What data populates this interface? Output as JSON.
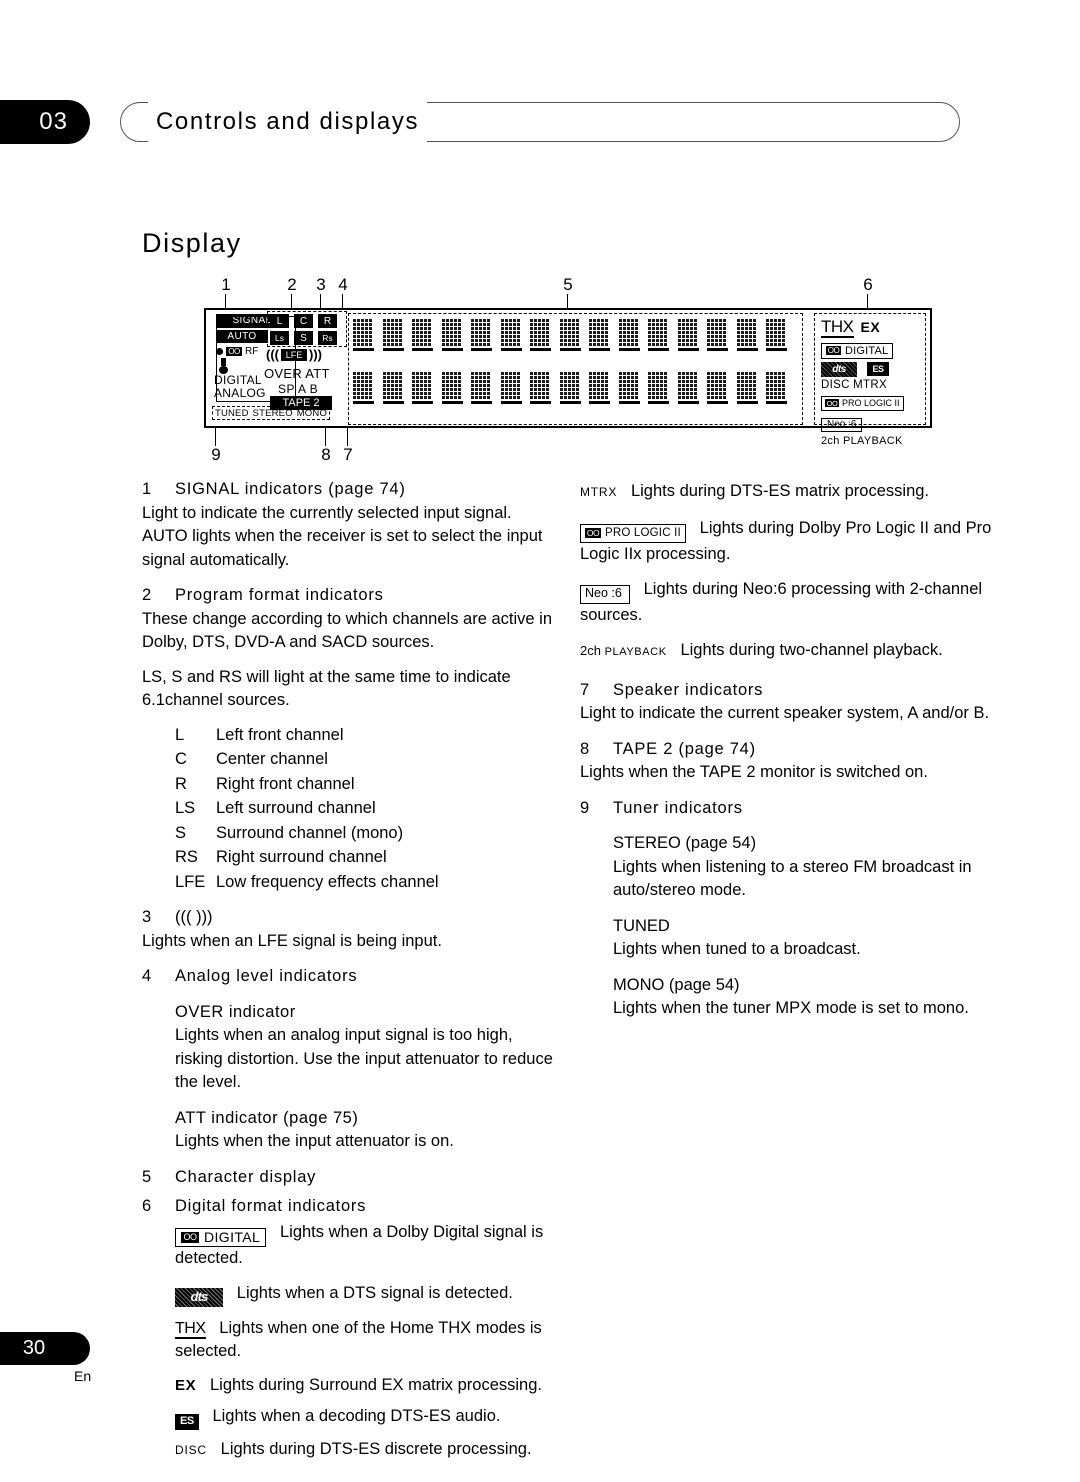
{
  "header": {
    "chapter_number": "03",
    "chapter_title": "Controls and displays"
  },
  "section_title": "Display",
  "diagram": {
    "callouts": [
      "1",
      "2",
      "3",
      "4",
      "5",
      "6",
      "7",
      "8",
      "9"
    ],
    "left_panel": {
      "signal": "SIGNAL",
      "auto": "AUTO",
      "rf": "RF",
      "dolby_glyph": "OO",
      "digital": "DIGITAL",
      "analog": "ANALOG",
      "tuner_row": [
        "TUNED",
        "STEREO",
        "MONO"
      ]
    },
    "program_format": {
      "row1": [
        "L",
        "C",
        "R"
      ],
      "row2": [
        "Ls",
        "S",
        "Rs"
      ],
      "lfe": "LFE",
      "paren_left": "(((",
      "paren_right": ")))"
    },
    "analog_level": "OVER ATT",
    "speaker": "SP    A B",
    "tape2": "TAPE 2",
    "character_display": {
      "columns": 15,
      "rows": 2
    },
    "right_panel": {
      "thx": "THX",
      "ex": "EX",
      "dolby_glyph": "OO",
      "dolby_digital": "DIGITAL",
      "dts": "dts",
      "es": "ES",
      "disc_mtrx": "DISC MTRX",
      "pro_logic": "PRO LOGIC II",
      "neo6": "Neo :6",
      "two_ch_playback": "2ch  PLAYBACK"
    }
  },
  "left_column": {
    "item1": {
      "num": "1",
      "head": "SIGNAL indicators (page 74)",
      "body": "Light to indicate the currently selected input signal. AUTO lights when the receiver is set to select the input signal automatically."
    },
    "item2": {
      "num": "2",
      "head": "Program format indicators",
      "body1": "These change according to which channels are active in Dolby, DTS, DVD-A and SACD sources.",
      "body2": "LS, S and RS will light at the same time to indicate 6.1channel sources.",
      "channels": [
        {
          "key": "L",
          "desc": "Left front channel"
        },
        {
          "key": "C",
          "desc": "Center channel"
        },
        {
          "key": "R",
          "desc": "Right front channel"
        },
        {
          "key": "LS",
          "desc": "Left surround channel"
        },
        {
          "key": "S",
          "desc": "Surround channel (mono)"
        },
        {
          "key": "RS",
          "desc": "Right surround channel"
        },
        {
          "key": "LFE",
          "desc": "Low frequency effects channel"
        }
      ]
    },
    "item3": {
      "num": "3",
      "head": "(((  )))",
      "body": "Lights when an LFE signal is being input."
    },
    "item4": {
      "num": "4",
      "head": "Analog level indicators",
      "over_head": "OVER indicator",
      "over_body": "Lights when an analog input signal is too high, risking distortion. Use the input attenuator to reduce the level.",
      "att_head": "ATT indicator (page 75)",
      "att_body": "Lights when the input attenuator is on."
    },
    "item5": {
      "num": "5",
      "head": "Character display"
    },
    "item6": {
      "num": "6",
      "head": "Digital format indicators",
      "dolby_digital_badge_glyph": "OO",
      "dolby_digital_badge_text": "DIGITAL",
      "dolby_digital_desc": "Lights when a Dolby Digital signal is detected.",
      "dts_badge": "dts",
      "dts_desc": "Lights when a DTS signal is detected.",
      "thx_badge": "THX",
      "thx_desc": "Lights when one of the Home THX modes is selected.",
      "ex_badge": "EX",
      "ex_desc": "Lights during Surround EX matrix processing.",
      "es_badge": "ES",
      "es_desc": "Lights when a decoding DTS-ES audio.",
      "disc_badge": "DISC",
      "disc_desc": "Lights during DTS-ES discrete processing."
    }
  },
  "right_column": {
    "mtrx_badge": "MTRX",
    "mtrx_desc": "Lights during DTS-ES matrix processing.",
    "prologic_badge_glyph": "OO",
    "prologic_badge_text": "PRO LOGIC II",
    "prologic_desc": "Lights during Dolby Pro Logic II and Pro Logic IIx processing.",
    "neo6_badge": "Neo :6",
    "neo6_desc": "Lights during Neo:6 processing with 2-channel sources.",
    "twoch_badge_a": "2ch",
    "twoch_badge_b": "PLAYBACK",
    "twoch_desc": "Lights during two-channel playback.",
    "item7": {
      "num": "7",
      "head": "Speaker indicators",
      "body": "Light to indicate the current speaker system, A and/or B."
    },
    "item8": {
      "num": "8",
      "head": "TAPE 2 (page 74)",
      "body": "Lights when the TAPE 2 monitor is switched on."
    },
    "item9": {
      "num": "9",
      "head": "Tuner indicators",
      "stereo_head": "STEREO (page 54)",
      "stereo_body": "Lights when listening to a stereo FM broadcast in auto/stereo mode.",
      "tuned_head": "TUNED",
      "tuned_body": "Lights when tuned to a broadcast.",
      "mono_head": "MONO (page 54)",
      "mono_body": "Lights when the tuner MPX mode is set to mono."
    }
  },
  "footer": {
    "page_number": "30",
    "language": "En"
  }
}
